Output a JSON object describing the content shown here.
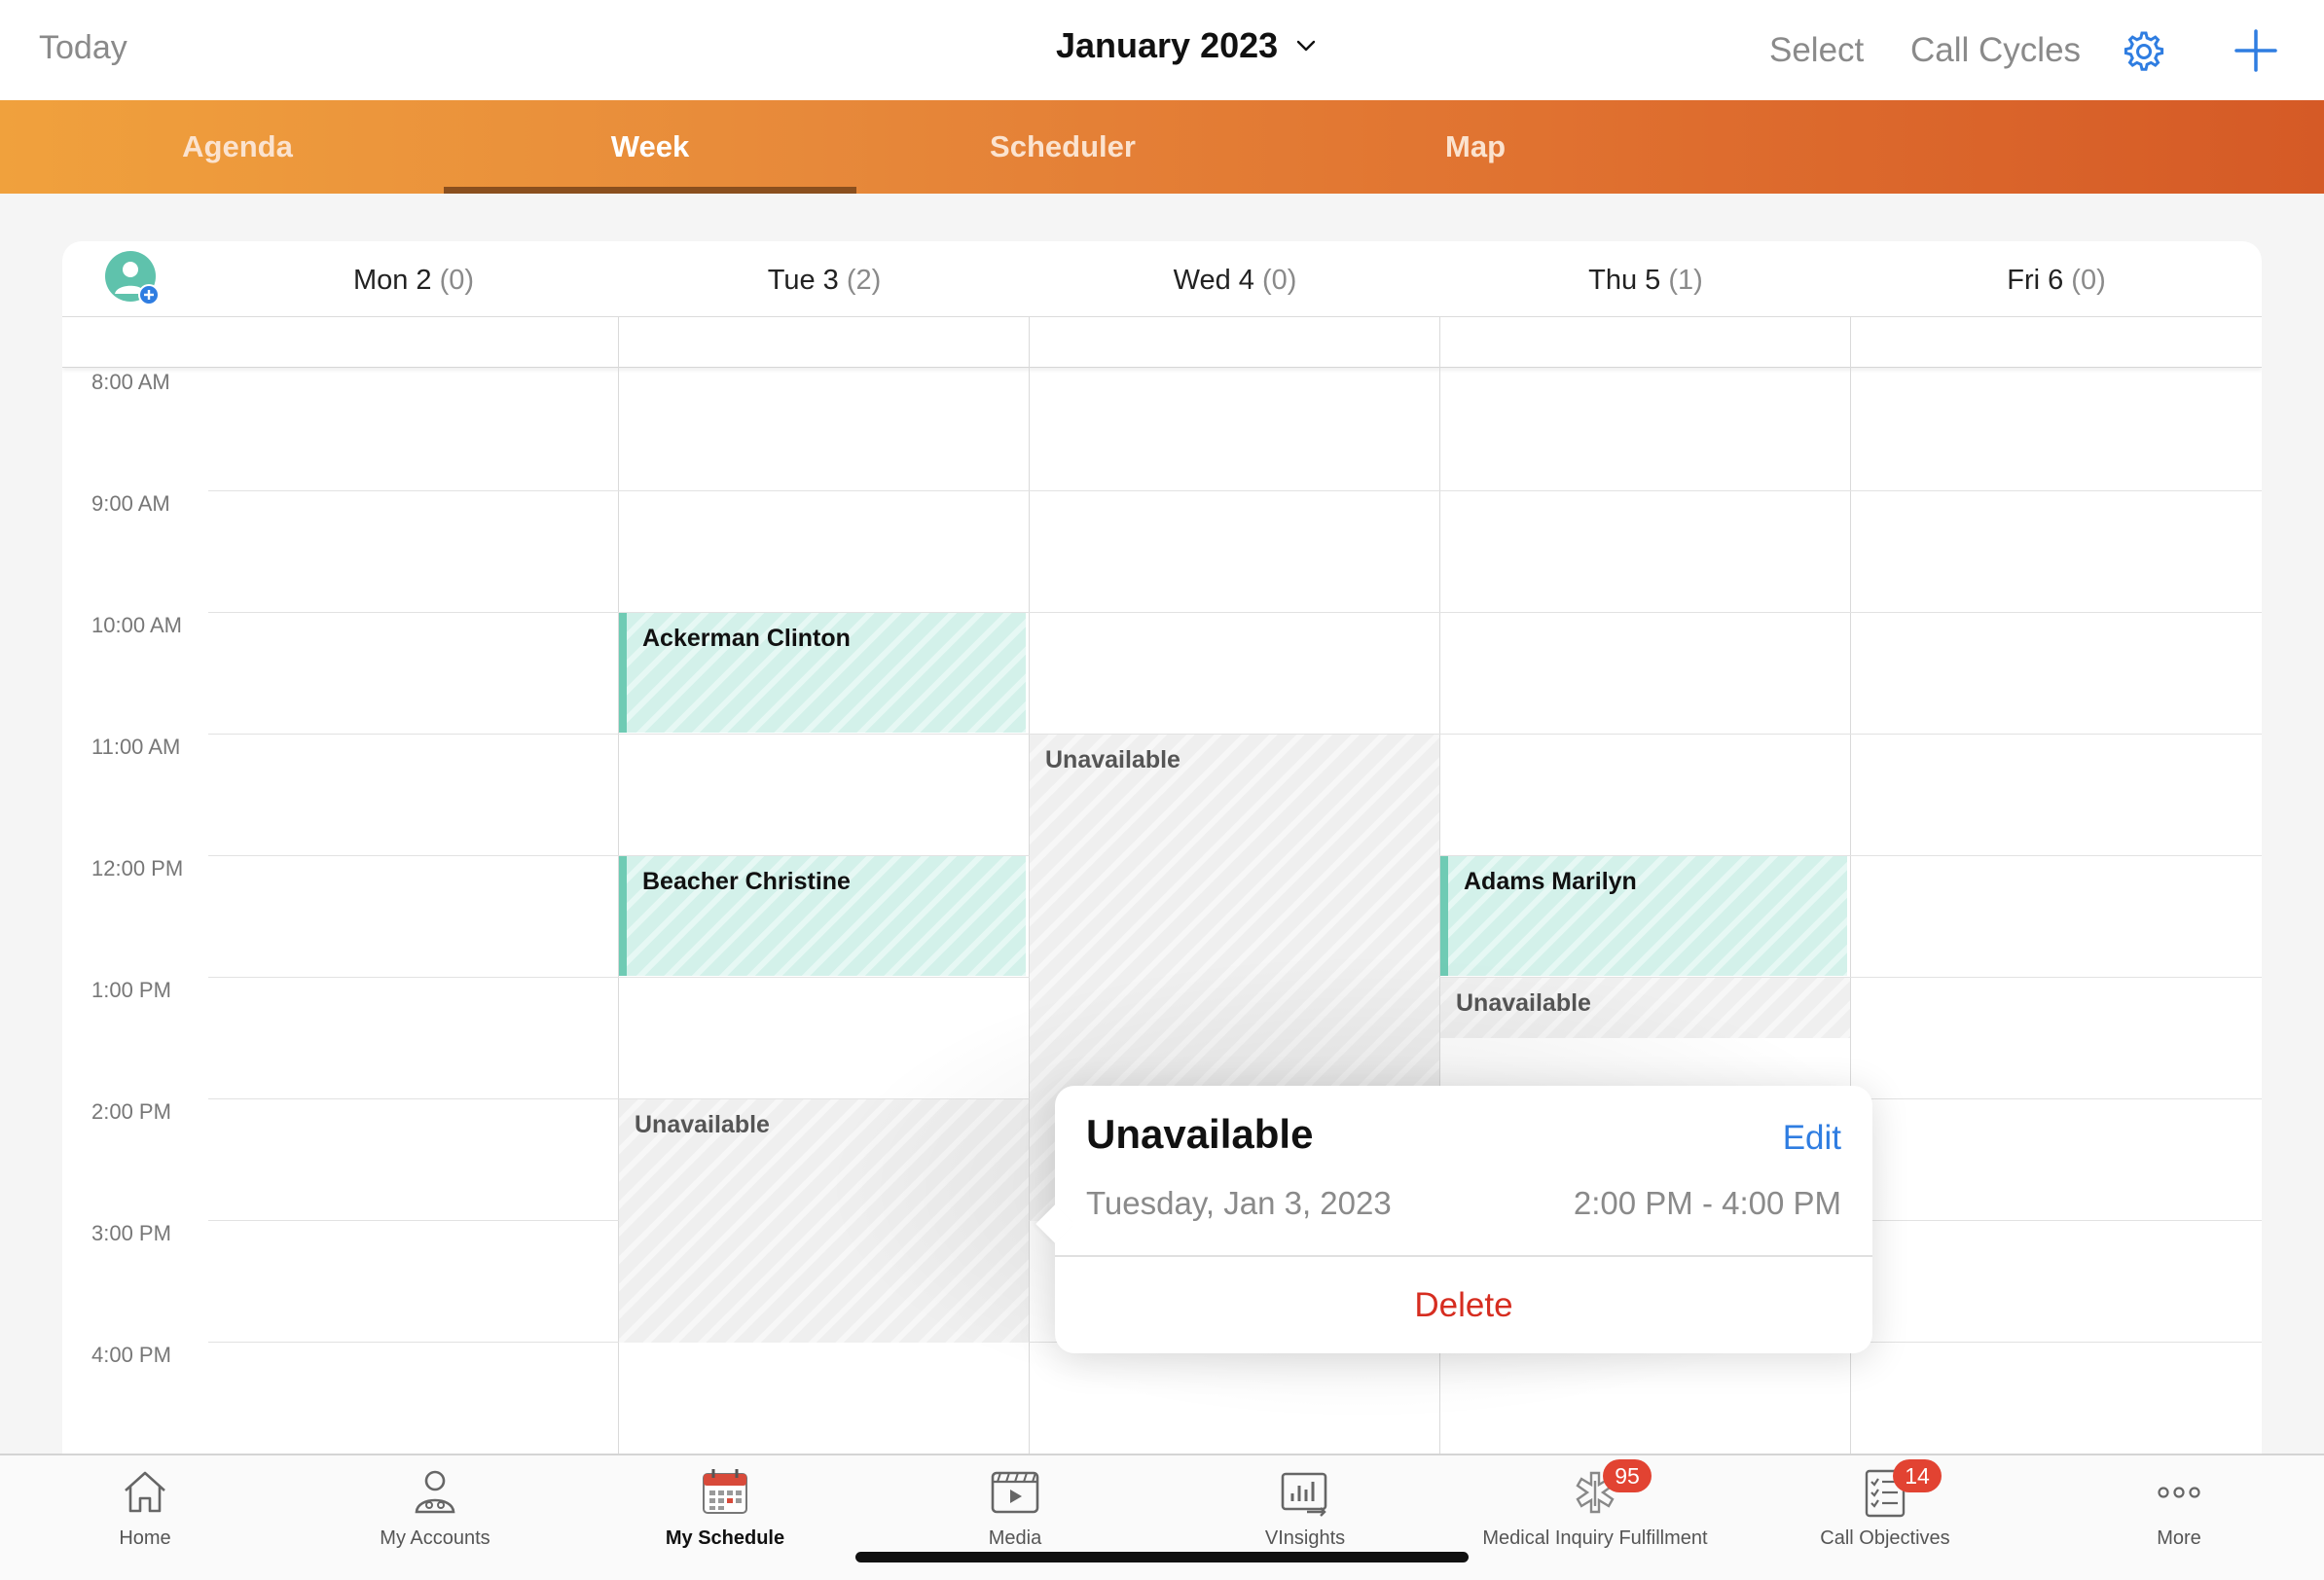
{
  "header": {
    "today_label": "Today",
    "month_title": "January 2023",
    "select_label": "Select",
    "call_cycles_label": "Call Cycles",
    "settings_icon": "gear-icon",
    "add_icon": "plus-icon",
    "accent_color": "#2f7de1"
  },
  "tabs": [
    {
      "label": "Agenda",
      "active": false
    },
    {
      "label": "Week",
      "active": true
    },
    {
      "label": "Scheduler",
      "active": false
    },
    {
      "label": "Map",
      "active": false
    }
  ],
  "calendar": {
    "days": [
      {
        "name": "Mon 2",
        "count": "(0)"
      },
      {
        "name": "Tue 3",
        "count": "(2)"
      },
      {
        "name": "Wed 4",
        "count": "(0)"
      },
      {
        "name": "Thu 5",
        "count": "(1)"
      },
      {
        "name": "Fri 6",
        "count": "(0)"
      }
    ],
    "times": [
      "8:00 AM",
      "9:00 AM",
      "10:00 AM",
      "11:00 AM",
      "12:00 PM",
      "1:00 PM",
      "2:00 PM",
      "3:00 PM",
      "4:00 PM"
    ],
    "events": [
      {
        "label": "Ackerman Clinton",
        "type": "call",
        "day": "Tue 3",
        "start": "10:00 AM",
        "end": "11:00 AM"
      },
      {
        "label": "Beacher Christine",
        "type": "call",
        "day": "Tue 3",
        "start": "12:00 PM",
        "end": "1:00 PM"
      },
      {
        "label": "Adams Marilyn",
        "type": "call",
        "day": "Thu 5",
        "start": "12:00 PM",
        "end": "1:00 PM"
      },
      {
        "label": "Unavailable",
        "type": "unavailable",
        "day": "Wed 4",
        "start": "11:00 AM",
        "end": "3:00 PM"
      },
      {
        "label": "Unavailable",
        "type": "unavailable",
        "day": "Thu 5",
        "start": "1:00 PM",
        "end": "1:30 PM"
      },
      {
        "label": "Unavailable",
        "type": "unavailable",
        "day": "Tue 3",
        "start": "2:00 PM",
        "end": "4:00 PM"
      }
    ],
    "call_color": "#6fcbb4"
  },
  "popover": {
    "title": "Unavailable",
    "edit_label": "Edit",
    "date": "Tuesday, Jan 3, 2023",
    "time_range": "2:00 PM - 4:00 PM",
    "delete_label": "Delete",
    "delete_color": "#d62d20"
  },
  "bottom_nav": [
    {
      "label": "Home",
      "icon": "home-icon"
    },
    {
      "label": "My Accounts",
      "icon": "accounts-icon"
    },
    {
      "label": "My Schedule",
      "icon": "calendar-icon",
      "active": true
    },
    {
      "label": "Media",
      "icon": "media-icon"
    },
    {
      "label": "VInsights",
      "icon": "insights-icon"
    },
    {
      "label": "Medical Inquiry Fulfillment",
      "icon": "medical-icon",
      "badge": "95"
    },
    {
      "label": "Call Objectives",
      "icon": "checklist-icon",
      "badge": "14"
    },
    {
      "label": "More",
      "icon": "more-icon"
    }
  ]
}
